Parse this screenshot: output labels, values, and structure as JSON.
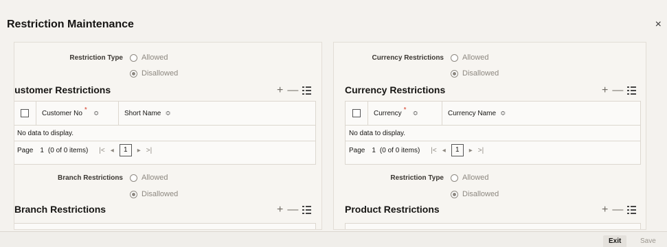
{
  "window": {
    "title": "Restriction Maintenance",
    "close_glyph": "×"
  },
  "left": {
    "restriction_type": {
      "label": "Restriction Type",
      "options": [
        "Allowed",
        "Disallowed"
      ],
      "selected": "Disallowed"
    },
    "customer": {
      "title": "Customer Restrictions",
      "columns": [
        "Customer No",
        "Short Name"
      ],
      "empty": "No data to display.",
      "pager": {
        "label": "Page",
        "page": "1",
        "info": "(0 of 0 items)"
      }
    },
    "branch_restrictions": {
      "label": "Branch Restrictions",
      "options": [
        "Allowed",
        "Disallowed"
      ],
      "selected": "Disallowed"
    },
    "branch": {
      "title": "Branch Restrictions"
    }
  },
  "right": {
    "currency_restrictions": {
      "label": "Currency Restrictions",
      "options": [
        "Allowed",
        "Disallowed"
      ],
      "selected": "Disallowed"
    },
    "currency": {
      "title": "Currency Restrictions",
      "columns": [
        "Currency",
        "Currency Name"
      ],
      "empty": "No data to display.",
      "pager": {
        "label": "Page",
        "page": "1",
        "info": "(0 of 0 items)"
      }
    },
    "restriction_type": {
      "label": "Restriction Type",
      "options": [
        "Allowed",
        "Disallowed"
      ],
      "selected": "Disallowed"
    },
    "product": {
      "title": "Product Restrictions"
    }
  },
  "toolbar": {
    "add_glyph": "+",
    "remove_glyph": "—"
  },
  "sort_glyph": "≎",
  "pager_nav": {
    "first": "|<",
    "prev": "◂",
    "next": "▸",
    "last": ">|"
  },
  "footer": {
    "exit_label": "Exit",
    "save_label": "Save"
  }
}
